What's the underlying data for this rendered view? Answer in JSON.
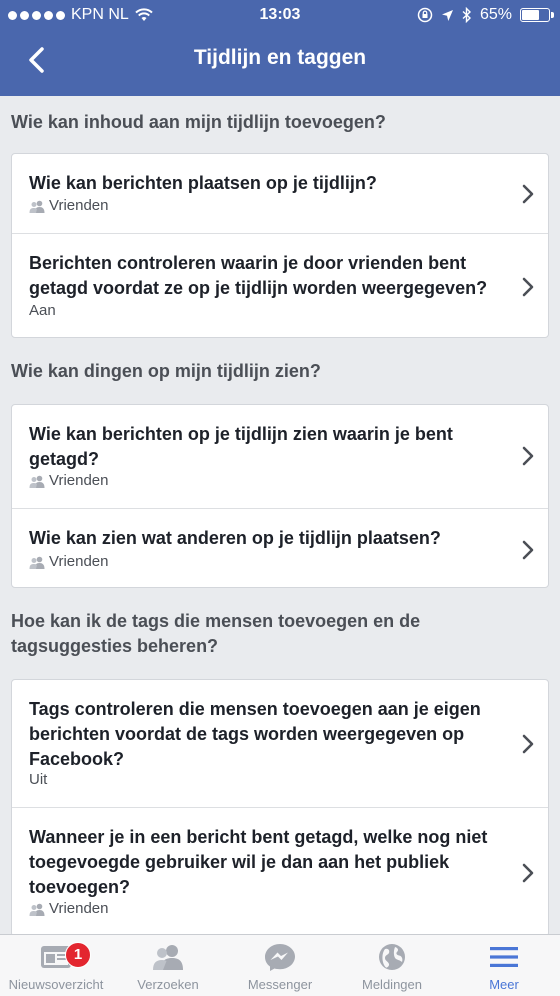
{
  "status_bar": {
    "carrier": "KPN NL",
    "time": "13:03",
    "battery": "65%",
    "battery_level": 0.65
  },
  "nav": {
    "title": "Tijdlijn en taggen",
    "back_icon": "chevron-left-icon"
  },
  "sections": [
    {
      "header": "Wie kan inhoud aan mijn tijdlijn toevoegen?",
      "rows": [
        {
          "title": "Wie kan berichten plaatsen op je tijdlijn?",
          "value": "Vrienden",
          "icon": "friends-icon"
        },
        {
          "title": "Berichten controleren waarin je door vrienden bent getagd voordat ze op je tijdlijn worden weergegeven?",
          "value": "Aan"
        }
      ]
    },
    {
      "header": "Wie kan dingen op mijn tijdlijn zien?",
      "rows": [
        {
          "title": "Wie kan berichten op je tijdlijn zien waarin je bent getagd?",
          "value": "Vrienden",
          "icon": "friends-icon"
        },
        {
          "title": "Wie kan zien wat anderen op je tijdlijn plaatsen?",
          "value": "Vrienden",
          "icon": "friends-icon"
        }
      ]
    },
    {
      "header": "Hoe kan ik de tags die mensen toevoegen en de tagsuggesties beheren?",
      "rows": [
        {
          "title": "Tags controleren die mensen toevoegen aan je eigen berichten voordat de tags worden weergegeven op Facebook?",
          "value": "Uit"
        },
        {
          "title": "Wanneer je in een bericht bent getagd, welke nog niet toegevoegde gebruiker wil je dan aan het publiek toevoegen?",
          "value": "Vrienden",
          "icon": "friends-icon"
        }
      ]
    }
  ],
  "tabbar": {
    "tabs": [
      {
        "label": "Nieuwsoverzicht",
        "icon": "news-feed-icon",
        "badge": "1"
      },
      {
        "label": "Verzoeken",
        "icon": "friend-requests-icon"
      },
      {
        "label": "Messenger",
        "icon": "messenger-icon"
      },
      {
        "label": "Meldingen",
        "icon": "globe-icon"
      },
      {
        "label": "Meer",
        "icon": "menu-icon",
        "active": true
      }
    ]
  },
  "colors": {
    "brand_blue": "#4a67ad",
    "active_tab": "#4a76d6",
    "badge_red": "#e3262f",
    "background": "#e9ebee"
  }
}
